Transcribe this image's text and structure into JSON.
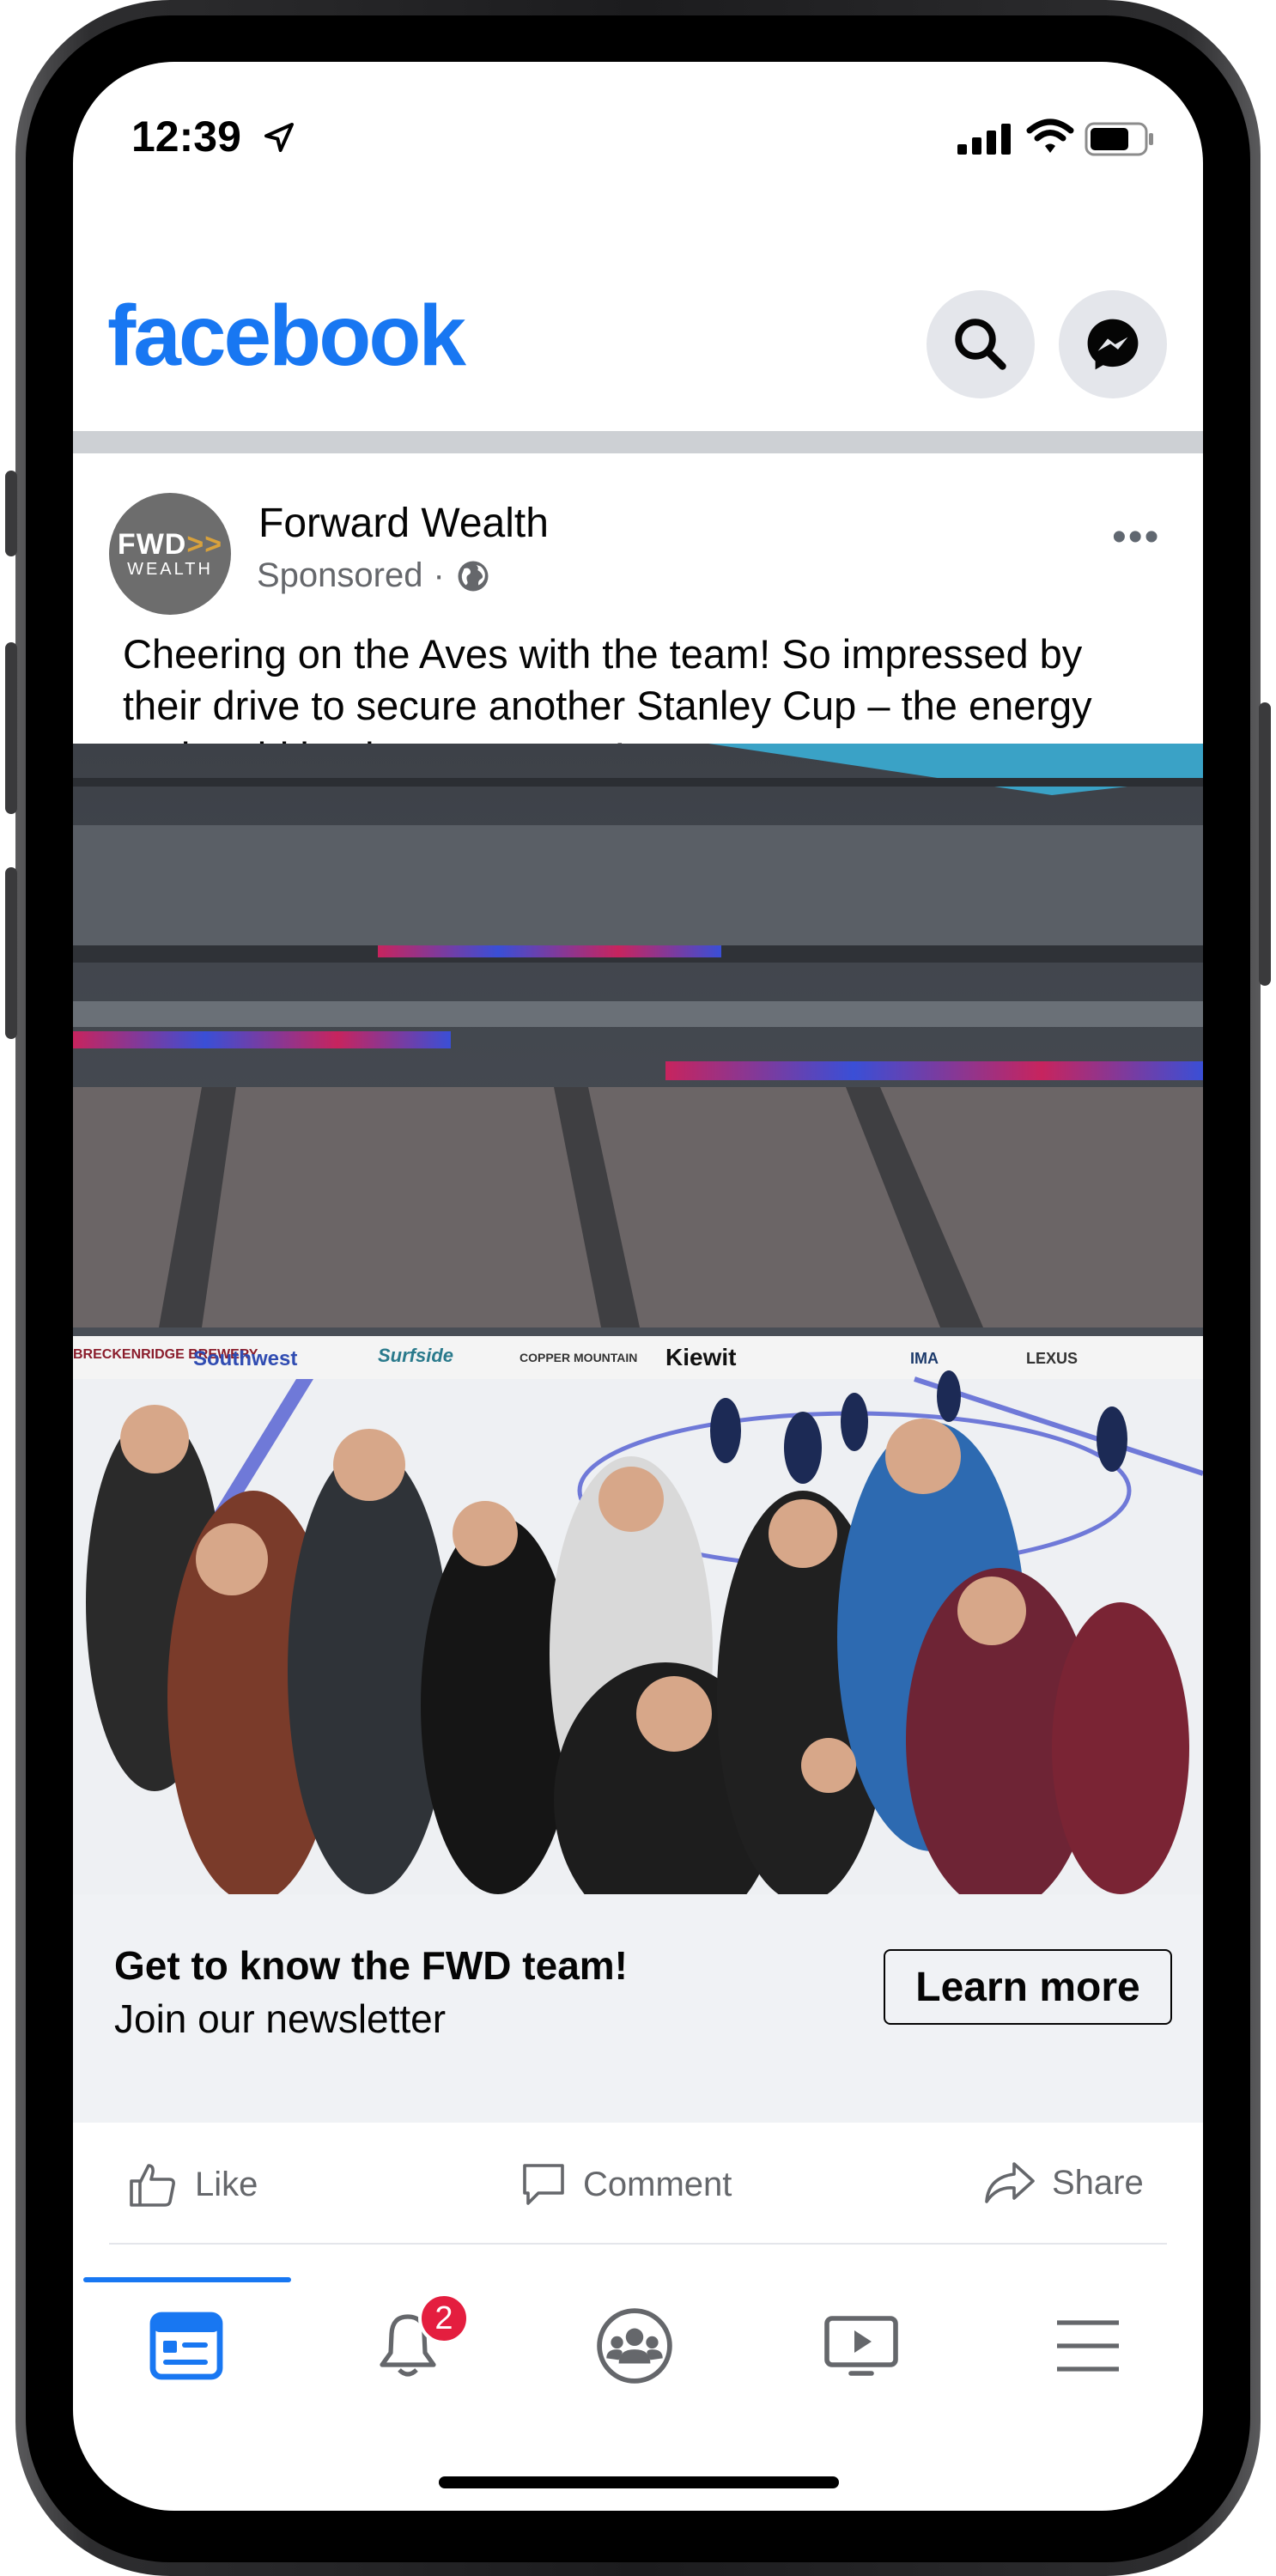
{
  "status_bar": {
    "time": "12:39"
  },
  "header": {
    "logo": "facebook",
    "buttons": [
      "search-icon",
      "messenger-icon"
    ]
  },
  "post": {
    "page_name": "Forward Wealth",
    "avatar": {
      "line1_left": "FWD",
      "line1_right": ">>",
      "line2": "WEALTH"
    },
    "sponsored": "Sponsored",
    "dot": "·",
    "more": "•••",
    "text": "Cheering on the Aves with the team! So impressed by their drive to secure another Stanley Cup – the energy and ambition is contageous!",
    "photo": {
      "boards": [
        "BRECKENRIDGE BREWERY",
        "Southwest",
        "Surfside",
        "COPPER MOUNTAIN",
        "Kiewit",
        "IMA",
        "LEXUS"
      ]
    }
  },
  "cta": {
    "title": "Get to know the FWD team!",
    "subtitle": "Join our newsletter",
    "button": "Learn more"
  },
  "actions": {
    "like": "Like",
    "comment": "Comment",
    "share": "Share"
  },
  "tabs": {
    "items": [
      "home-icon",
      "bell-icon",
      "groups-icon",
      "watch-icon",
      "menu-icon"
    ],
    "notification_count": "2"
  },
  "colors": {
    "brand": "#1877f2",
    "badge": "#e41e3f",
    "cta_bg": "#f0f2f5"
  }
}
